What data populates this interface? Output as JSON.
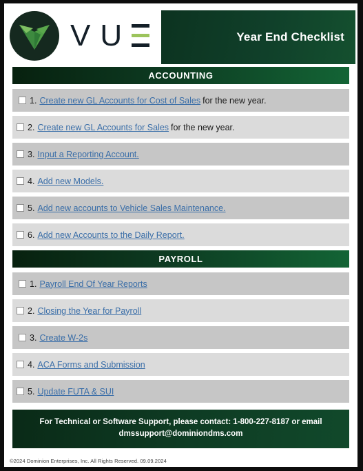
{
  "document": {
    "title": "Year End Checklist",
    "brand_name": "VUE",
    "brand_letters": [
      "V",
      "U"
    ],
    "logo_icon": "vue-v-logo-icon",
    "colors": {
      "dark_green": "#0a2a17",
      "mid_green": "#136435",
      "accent_green": "#9cc45c",
      "link_blue": "#3a6ea8",
      "row_shade_a": "#c6c6c6",
      "row_shade_b": "#dbdbdb"
    }
  },
  "sections": [
    {
      "heading": "ACCOUNTING",
      "items": [
        {
          "number": "1.",
          "link": "Create new GL Accounts for Cost of Sales",
          "tail": "for the new year."
        },
        {
          "number": "2.",
          "link": "Create new GL Accounts for Sales",
          "tail": "for the new year."
        },
        {
          "number": "3.",
          "link": "Input a Reporting Account.",
          "tail": ""
        },
        {
          "number": "4.",
          "link": "Add new Models.",
          "tail": ""
        },
        {
          "number": "5.",
          "link": "Add new accounts to Vehicle Sales Maintenance.",
          "tail": ""
        },
        {
          "number": "6.",
          "link": "Add new Accounts to the Daily Report.",
          "tail": ""
        }
      ]
    },
    {
      "heading": "PAYROLL",
      "items": [
        {
          "number": "1.",
          "link": "Payroll End Of Year Reports",
          "tail": ""
        },
        {
          "number": "2.",
          "link": "Closing the Year for Payroll",
          "tail": ""
        },
        {
          "number": "3.",
          "link": "Create W-2s",
          "tail": ""
        },
        {
          "number": "4.",
          "link": "ACA Forms and Submission",
          "tail": ""
        },
        {
          "number": "5.",
          "link": "Update FUTA & SUI",
          "tail": ""
        }
      ]
    }
  ],
  "support": {
    "line1": "For Technical or Software Support, please contact:  1-800-227-8187 or email",
    "line2": "dmssupport@dominiondms.com"
  },
  "copyright": "©2024 Dominion Enterprises, Inc. All Rights Reserved. 09.09.2024"
}
